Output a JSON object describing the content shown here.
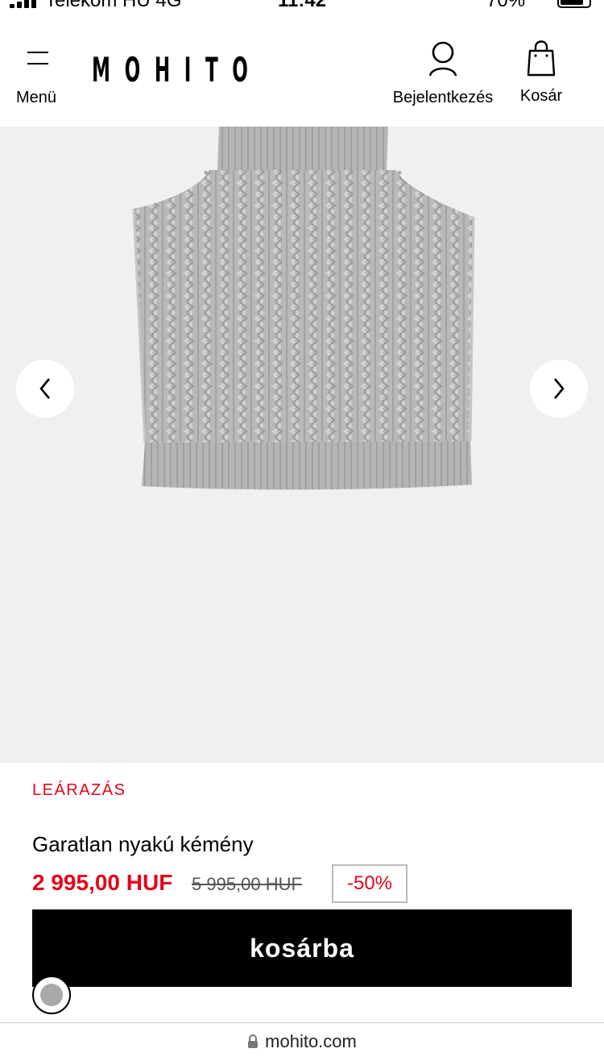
{
  "status_bar": {
    "carrier": "Telekom HU  4G",
    "time": "11:42",
    "battery": "70%"
  },
  "header": {
    "menu_label": "Menü",
    "logo": "MOHITO",
    "login_label": "Bejelentkezés",
    "cart_label": "Kosár"
  },
  "gallery": {
    "prev_icon": "chevron-left-icon",
    "next_icon": "chevron-right-icon"
  },
  "product": {
    "sale_label": "LEÁRAZÁS",
    "name": "Garatlan nyakú kémény",
    "price_current": "2 995,00 HUF",
    "price_old": "5 995,00 HUF",
    "discount": "-50%",
    "add_to_cart": "kosárba",
    "swatch_color": "#a9a9a9"
  },
  "browser": {
    "url": "mohito.com"
  },
  "colors": {
    "sale_red": "#e1061a",
    "button_black": "#000000",
    "gallery_bg": "#f0f0f0"
  }
}
